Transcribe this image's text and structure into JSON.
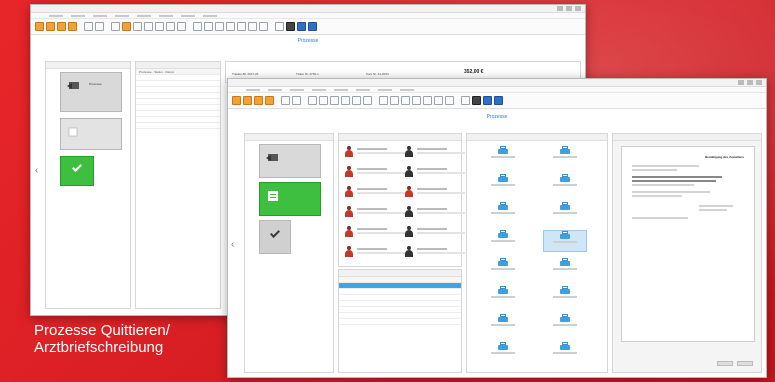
{
  "caption": {
    "line1": "Prozesse Quittieren/",
    "line2": "Arztbriefschreibung"
  },
  "colors": {
    "background": "#d91f24",
    "accent_green": "#3fbf3f",
    "accent_blue": "#2b7bd6",
    "selection_blue": "#3fa6e6"
  },
  "back_window": {
    "section_title": "Prozesse",
    "cards": [
      {
        "icon": "document-arrow-icon",
        "label": "Prozesse"
      },
      {
        "icon": "blank-icon",
        "label": ""
      },
      {
        "icon": "checkmark-icon",
        "label": ""
      }
    ],
    "list_header": [
      "Prozesse",
      "Status",
      "Datum"
    ],
    "info_header": [
      "Tracker-Bl. 2017-24",
      "Ticket Nr. 4765-1",
      "Kurs Nr. 41-2024"
    ],
    "amount": "352,00 €"
  },
  "front_window": {
    "section_title": "Prozesse",
    "cards": [
      {
        "icon": "document-arrow-icon",
        "label": ""
      },
      {
        "icon": "document-lines-icon",
        "label": ""
      },
      {
        "icon": "checkmark-icon",
        "label": ""
      }
    ],
    "persons": [
      {
        "gender": "f"
      },
      {
        "gender": "m"
      },
      {
        "gender": "f"
      },
      {
        "gender": "m"
      },
      {
        "gender": "f"
      },
      {
        "gender": "f"
      },
      {
        "gender": "f"
      },
      {
        "gender": "m"
      },
      {
        "gender": "f"
      },
      {
        "gender": "m"
      },
      {
        "gender": "f"
      },
      {
        "gender": "m"
      }
    ],
    "devices": [
      {
        "selected": false
      },
      {
        "selected": false
      },
      {
        "selected": false
      },
      {
        "selected": false
      },
      {
        "selected": false
      },
      {
        "selected": false
      },
      {
        "selected": false
      },
      {
        "selected": true
      },
      {
        "selected": false
      },
      {
        "selected": false
      },
      {
        "selected": false
      },
      {
        "selected": false
      },
      {
        "selected": false
      },
      {
        "selected": false
      },
      {
        "selected": false
      },
      {
        "selected": false
      }
    ],
    "document_title": "Bestätigung des Zustellens"
  }
}
